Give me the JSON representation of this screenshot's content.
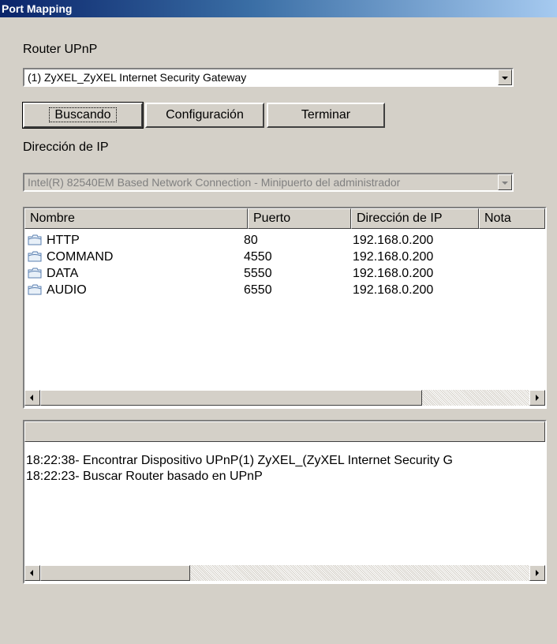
{
  "window": {
    "title": "Port Mapping"
  },
  "router": {
    "label": "Router UPnP",
    "selected": "(1) ZyXEL_ZyXEL Internet Security Gateway"
  },
  "buttons": {
    "search": "Buscando",
    "config": "Configuración",
    "finish": "Terminar"
  },
  "ip": {
    "label": "Dirección de IP",
    "selected": "Intel(R) 82540EM Based Network Connection - Minipuerto del administrador"
  },
  "ports_table": {
    "columns": [
      "Nombre",
      "Puerto",
      "Dirección de IP",
      "Nota"
    ],
    "rows": [
      {
        "name": "HTTP",
        "port": "80",
        "ip": "192.168.0.200",
        "note": ""
      },
      {
        "name": "COMMAND",
        "port": "4550",
        "ip": "192.168.0.200",
        "note": ""
      },
      {
        "name": "DATA",
        "port": "5550",
        "ip": "192.168.0.200",
        "note": ""
      },
      {
        "name": "AUDIO",
        "port": "6550",
        "ip": "192.168.0.200",
        "note": ""
      }
    ]
  },
  "log": {
    "lines": [
      "18:22:38- Encontrar Dispositivo UPnP(1) ZyXEL_(ZyXEL Internet Security G",
      "18:22:23- Buscar Router basado en UPnP"
    ]
  },
  "icons": {
    "row_icon": "folder-icon"
  }
}
